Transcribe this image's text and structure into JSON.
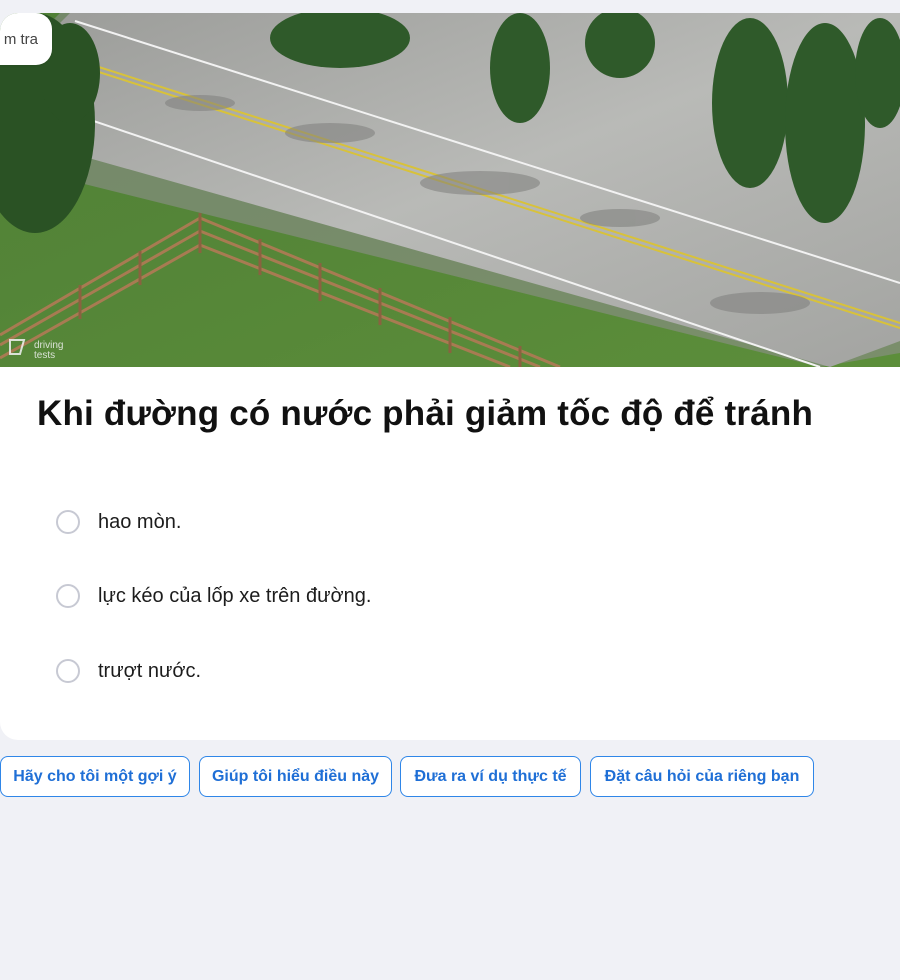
{
  "header": {
    "tag_label": "m tra"
  },
  "image": {
    "watermark_line1": "driving",
    "watermark_line2": "tests"
  },
  "question": {
    "text": "Khi đường có nước phải giảm tốc độ để tránh",
    "options": [
      {
        "label": "hao mòn."
      },
      {
        "label": "lực kéo của lốp xe trên đường."
      },
      {
        "label": "trượt nước."
      }
    ]
  },
  "help_actions": [
    {
      "label": "Hãy cho tôi một gợi ý"
    },
    {
      "label": "Giúp tôi hiểu điều này"
    },
    {
      "label": "Đưa ra ví dụ thực tế"
    },
    {
      "label": "Đặt câu hỏi của riêng bạn"
    }
  ],
  "colors": {
    "accent": "#2f86e8",
    "background": "#f0f1f6",
    "card": "#ffffff"
  }
}
